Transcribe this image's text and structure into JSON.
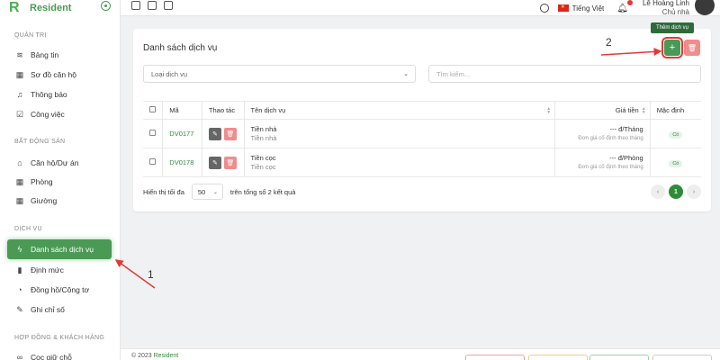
{
  "brand": {
    "name": "Resident"
  },
  "sidebar": {
    "sections": [
      {
        "title": "QUẢN TRỊ",
        "items": [
          "Bảng tin",
          "Sơ đồ căn hộ",
          "Thông báo",
          "Công việc"
        ]
      },
      {
        "title": "BẤT ĐỘNG SẢN",
        "items": [
          "Căn hộ/Dự án",
          "Phòng",
          "Giường"
        ]
      },
      {
        "title": "DỊCH VỤ",
        "items": [
          "Danh sách dịch vụ",
          "Định mức",
          "Đồng hồ/Công tơ",
          "Ghi chỉ số"
        ]
      },
      {
        "title": "HỢP ĐỒNG & KHÁCH HÀNG",
        "items": [
          "Cọc giữ chỗ"
        ]
      }
    ],
    "active": "Danh sách dịch vụ"
  },
  "topbar": {
    "language": "Tiếng Việt",
    "user_name": "Lê Hoàng Linh",
    "user_role": "Chủ nhà"
  },
  "card": {
    "title": "Danh sách dịch vụ",
    "add_tooltip": "Thêm dịch vụ",
    "add_label": "+",
    "filter_placeholder": "Loại dịch vụ",
    "search_placeholder": "Tìm kiếm..."
  },
  "table": {
    "headers": [
      "Mã",
      "Thao tác",
      "Tên dịch vụ",
      "Giá tiền",
      "Mặc định"
    ],
    "rows": [
      {
        "code": "DV0177",
        "name": "Tiền nhà",
        "sub": "Tiền nhà",
        "price": "--- đ/Tháng",
        "price_note": "Đơn giá cố định theo tháng",
        "default": "Có"
      },
      {
        "code": "DV0178",
        "name": "Tiền cọc",
        "sub": "Tiền cọc",
        "price": "--- đ/Phòng",
        "price_note": "Đơn giá cố định theo tháng",
        "default": "Có"
      }
    ]
  },
  "pagination": {
    "show_label": "Hiển thị tối đa",
    "page_size": "50",
    "total_label": "trên tổng số 2 kết quả",
    "current_page": "1"
  },
  "annotations": {
    "label_1": "1",
    "label_2": "2",
    "color": "#e53935"
  },
  "footer": {
    "copyright": "© 2023 ",
    "brand": "Resident"
  },
  "colors": {
    "accent": "#4a9a55",
    "danger": "#f28b8b",
    "highlight": "#e53935"
  }
}
